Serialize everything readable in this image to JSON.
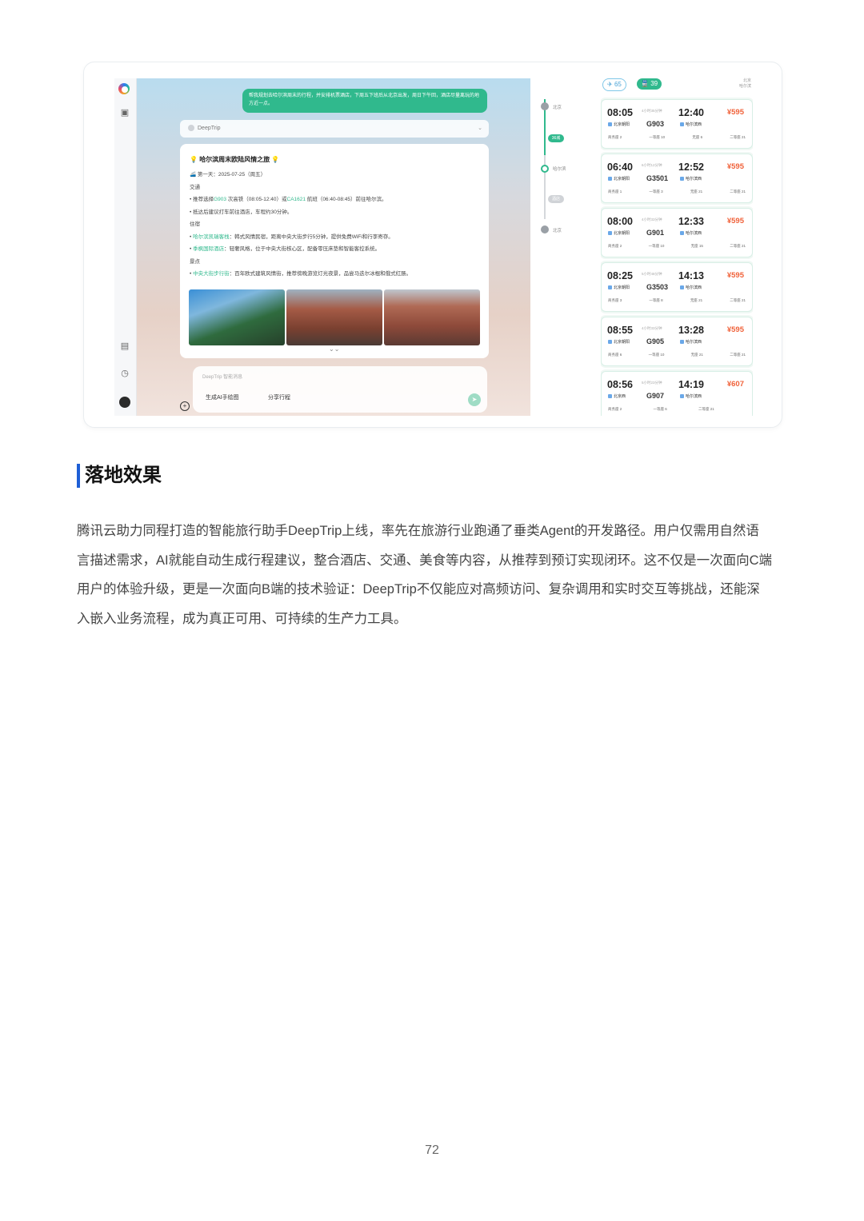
{
  "app": {
    "user_message": "帮我规划去哈尔滨周末的行程，并安排机票酒店，下周五下班后从北京出发，周日下午回，酒店尽量离玩的地方近一点。",
    "agent_name": "DeepTrip",
    "itinerary": {
      "title": "哈尔滨周末欧陆风情之旅",
      "day1": "第一天：2025-07-25（周五）",
      "transport_label": "交通",
      "transport_line1_a": "推荐选择",
      "transport_train": "G903",
      "transport_line1_b": " 次高铁（08:05-12:40）或",
      "transport_flight": "CA1621",
      "transport_line1_c": " 航班（06:40-08:45）前往哈尔滨。",
      "transport_line2": "抵达后建议打车前往酒店，车程约30分钟。",
      "hotel_label": "住宿",
      "hotel1_name": "哈尔滨凯瑞客栈",
      "hotel1_desc": "：韩式风情民宿，距离中央大街步行5分钟，提供免费WiFi和行李寄存。",
      "hotel2_name": "季枫国际酒店",
      "hotel2_desc": "：轻奢风格，位于中央大街核心区，配备零压床垫和智能客控系统。",
      "sight_label": "景点",
      "sight1_name": "中央大街步行街",
      "sight1_desc": "：百年欧式建筑风情街，推荐傍晚游览灯光夜景，品尝马迭尔冰棍和俄式红肠。"
    },
    "input_placeholder": "DeepTrip 智能消息",
    "chip_ai_draw": "生成AI手绘图",
    "chip_share": "分享行程",
    "route": {
      "stop1": "北京",
      "pill1": "36城",
      "stop2": "哈尔滨",
      "pill2": "酒店",
      "stop3": "北京"
    },
    "tabs": {
      "plane_count": "65",
      "train_count": "39",
      "corner_line1": "北京",
      "corner_line2": "哈尔滨"
    },
    "trains": [
      {
        "dep": "08:05",
        "dur": "4小时35分钟",
        "arr": "12:40",
        "no": "G903",
        "from": "北京朝阳",
        "to": "哈尔滨西",
        "price": "595",
        "seat1": "商务座 2",
        "seat2": "一等座 10",
        "seat3": "无座 6",
        "seat4": "二等座 21"
      },
      {
        "dep": "06:40",
        "dur": "6小时12分钟",
        "arr": "12:52",
        "no": "G3501",
        "from": "北京朝阳",
        "to": "哈尔滨西",
        "price": "595",
        "seat1": "商务座 1",
        "seat2": "一等座 3",
        "seat3": "无座 21",
        "seat4": "二等座 21"
      },
      {
        "dep": "08:00",
        "dur": "4小时33分钟",
        "arr": "12:33",
        "no": "G901",
        "from": "北京朝阳",
        "to": "哈尔滨西",
        "price": "595",
        "seat1": "商务座 2",
        "seat2": "一等座 10",
        "seat3": "无座 15",
        "seat4": "二等座 21"
      },
      {
        "dep": "08:25",
        "dur": "5小时48分钟",
        "arr": "14:13",
        "no": "G3503",
        "from": "北京朝阳",
        "to": "哈尔滨西",
        "price": "595",
        "seat1": "商务座 3",
        "seat2": "一等座 8",
        "seat3": "无座 21",
        "seat4": "二等座 21"
      },
      {
        "dep": "08:55",
        "dur": "4小时33分钟",
        "arr": "13:28",
        "no": "G905",
        "from": "北京朝阳",
        "to": "哈尔滨西",
        "price": "595",
        "seat1": "商务座 6",
        "seat2": "一等座 10",
        "seat3": "无座 21",
        "seat4": "二等座 21"
      },
      {
        "dep": "08:56",
        "dur": "5小时23分钟",
        "arr": "14:19",
        "no": "G907",
        "from": "北京西",
        "to": "哈尔滨西",
        "price": "607",
        "seat1": "商务座 2",
        "seat2": "一等座 6",
        "seat3": "二等座 21",
        "seat4": ""
      }
    ]
  },
  "document": {
    "heading": "落地效果",
    "para_lines": [
      "腾讯云助力同程打造的智能旅行助手DeepTrip上线，率先在旅游行业跑通了垂类Agent的开发路径。用户仅需用自然语",
      "言描述需求，AI就能自动生成行程建议，整合酒店、交通、美食等内容，从推荐到预订实现闭环。这不仅是一次面向C端",
      "用户的体验升级，更是一次面向B端的技术验证：DeepTrip不仅能应对高频访问、复杂调用和实时交互等挑战，还能深",
      "入嵌入业务流程，成为真正可用、可持续的生产力工具。"
    ],
    "page_number": "72"
  },
  "colors": {
    "accent_green": "#30b98d",
    "heading_bar": "#1e5fd6",
    "price_orange": "#f0623a"
  }
}
